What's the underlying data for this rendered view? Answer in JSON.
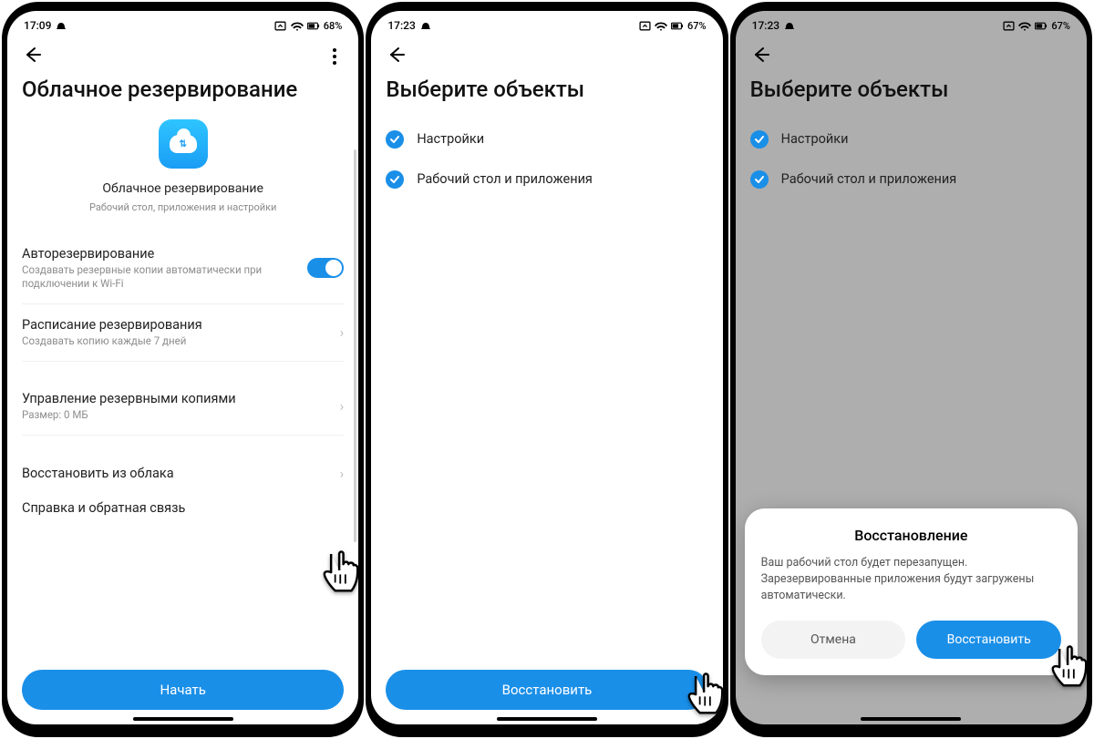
{
  "accent": "#1a8fe8",
  "phone1": {
    "status": {
      "time": "17:09",
      "battery": "68%"
    },
    "title": "Облачное резервирование",
    "center": {
      "title": "Облачное резервирование",
      "subtitle": "Рабочий стол, приложения и настройки"
    },
    "rows": {
      "autobackup": {
        "label": "Авторезервирование",
        "sub": "Создавать резервные копии автоматически при подключении к Wi-Fi",
        "toggle": true
      },
      "schedule": {
        "label": "Расписание резервирования",
        "sub": "Создавать копию каждые 7 дней"
      },
      "manage": {
        "label": "Управление резервными копиями",
        "sub": "Размер: 0 МБ"
      },
      "restore": {
        "label": "Восстановить из облака"
      },
      "help": {
        "label": "Справка и обратная связь"
      }
    },
    "primary_button": "Начать"
  },
  "phone2": {
    "status": {
      "time": "17:23",
      "battery": "67%"
    },
    "title": "Выберите объекты",
    "items": [
      {
        "label": "Настройки",
        "checked": true
      },
      {
        "label": "Рабочий стол и приложения",
        "checked": true
      }
    ],
    "primary_button": "Восстановить"
  },
  "phone3": {
    "status": {
      "time": "17:23",
      "battery": "67%"
    },
    "title": "Выберите объекты",
    "items": [
      {
        "label": "Настройки",
        "checked": true
      },
      {
        "label": "Рабочий стол и приложения",
        "checked": true
      }
    ],
    "dialog": {
      "title": "Восстановление",
      "body": "Ваш рабочий стол будет перезапущен. Зарезервированные приложения будут загружены автоматически.",
      "cancel": "Отмена",
      "confirm": "Восстановить"
    }
  }
}
